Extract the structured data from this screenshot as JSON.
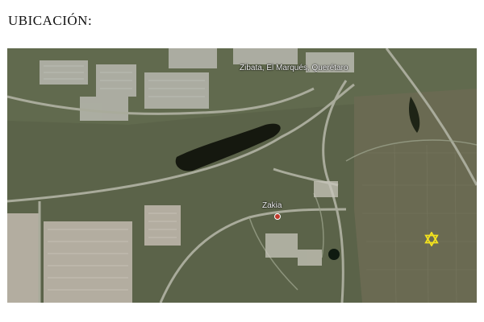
{
  "heading": "UBICACIÓN:",
  "map": {
    "labels": {
      "zibata": "Zibata, El Marqués, Querétaro",
      "zakia": "Zakia"
    },
    "marker_icon": "star-of-david-icon",
    "marker_color": "#f3e21d"
  }
}
